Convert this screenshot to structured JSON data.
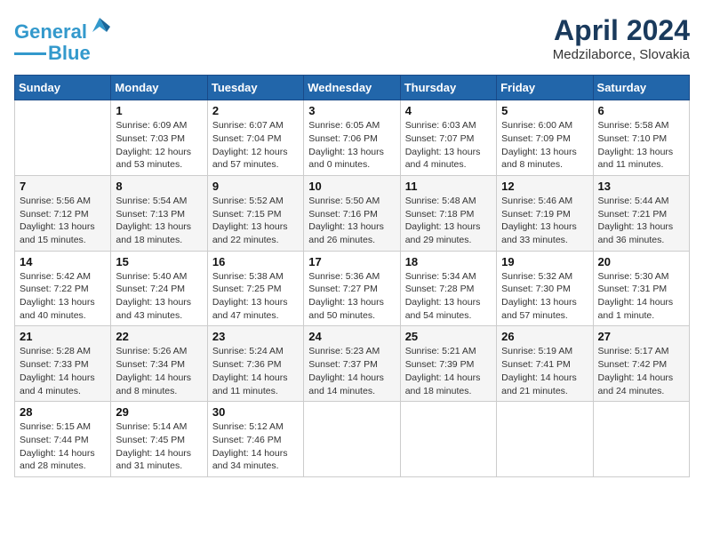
{
  "header": {
    "logo_line1": "General",
    "logo_line2": "Blue",
    "month_title": "April 2024",
    "location": "Medzilaborce, Slovakia"
  },
  "days_of_week": [
    "Sunday",
    "Monday",
    "Tuesday",
    "Wednesday",
    "Thursday",
    "Friday",
    "Saturday"
  ],
  "weeks": [
    [
      {
        "day": "",
        "sunrise": "",
        "sunset": "",
        "daylight": ""
      },
      {
        "day": "1",
        "sunrise": "Sunrise: 6:09 AM",
        "sunset": "Sunset: 7:03 PM",
        "daylight": "Daylight: 12 hours and 53 minutes."
      },
      {
        "day": "2",
        "sunrise": "Sunrise: 6:07 AM",
        "sunset": "Sunset: 7:04 PM",
        "daylight": "Daylight: 12 hours and 57 minutes."
      },
      {
        "day": "3",
        "sunrise": "Sunrise: 6:05 AM",
        "sunset": "Sunset: 7:06 PM",
        "daylight": "Daylight: 13 hours and 0 minutes."
      },
      {
        "day": "4",
        "sunrise": "Sunrise: 6:03 AM",
        "sunset": "Sunset: 7:07 PM",
        "daylight": "Daylight: 13 hours and 4 minutes."
      },
      {
        "day": "5",
        "sunrise": "Sunrise: 6:00 AM",
        "sunset": "Sunset: 7:09 PM",
        "daylight": "Daylight: 13 hours and 8 minutes."
      },
      {
        "day": "6",
        "sunrise": "Sunrise: 5:58 AM",
        "sunset": "Sunset: 7:10 PM",
        "daylight": "Daylight: 13 hours and 11 minutes."
      }
    ],
    [
      {
        "day": "7",
        "sunrise": "Sunrise: 5:56 AM",
        "sunset": "Sunset: 7:12 PM",
        "daylight": "Daylight: 13 hours and 15 minutes."
      },
      {
        "day": "8",
        "sunrise": "Sunrise: 5:54 AM",
        "sunset": "Sunset: 7:13 PM",
        "daylight": "Daylight: 13 hours and 18 minutes."
      },
      {
        "day": "9",
        "sunrise": "Sunrise: 5:52 AM",
        "sunset": "Sunset: 7:15 PM",
        "daylight": "Daylight: 13 hours and 22 minutes."
      },
      {
        "day": "10",
        "sunrise": "Sunrise: 5:50 AM",
        "sunset": "Sunset: 7:16 PM",
        "daylight": "Daylight: 13 hours and 26 minutes."
      },
      {
        "day": "11",
        "sunrise": "Sunrise: 5:48 AM",
        "sunset": "Sunset: 7:18 PM",
        "daylight": "Daylight: 13 hours and 29 minutes."
      },
      {
        "day": "12",
        "sunrise": "Sunrise: 5:46 AM",
        "sunset": "Sunset: 7:19 PM",
        "daylight": "Daylight: 13 hours and 33 minutes."
      },
      {
        "day": "13",
        "sunrise": "Sunrise: 5:44 AM",
        "sunset": "Sunset: 7:21 PM",
        "daylight": "Daylight: 13 hours and 36 minutes."
      }
    ],
    [
      {
        "day": "14",
        "sunrise": "Sunrise: 5:42 AM",
        "sunset": "Sunset: 7:22 PM",
        "daylight": "Daylight: 13 hours and 40 minutes."
      },
      {
        "day": "15",
        "sunrise": "Sunrise: 5:40 AM",
        "sunset": "Sunset: 7:24 PM",
        "daylight": "Daylight: 13 hours and 43 minutes."
      },
      {
        "day": "16",
        "sunrise": "Sunrise: 5:38 AM",
        "sunset": "Sunset: 7:25 PM",
        "daylight": "Daylight: 13 hours and 47 minutes."
      },
      {
        "day": "17",
        "sunrise": "Sunrise: 5:36 AM",
        "sunset": "Sunset: 7:27 PM",
        "daylight": "Daylight: 13 hours and 50 minutes."
      },
      {
        "day": "18",
        "sunrise": "Sunrise: 5:34 AM",
        "sunset": "Sunset: 7:28 PM",
        "daylight": "Daylight: 13 hours and 54 minutes."
      },
      {
        "day": "19",
        "sunrise": "Sunrise: 5:32 AM",
        "sunset": "Sunset: 7:30 PM",
        "daylight": "Daylight: 13 hours and 57 minutes."
      },
      {
        "day": "20",
        "sunrise": "Sunrise: 5:30 AM",
        "sunset": "Sunset: 7:31 PM",
        "daylight": "Daylight: 14 hours and 1 minute."
      }
    ],
    [
      {
        "day": "21",
        "sunrise": "Sunrise: 5:28 AM",
        "sunset": "Sunset: 7:33 PM",
        "daylight": "Daylight: 14 hours and 4 minutes."
      },
      {
        "day": "22",
        "sunrise": "Sunrise: 5:26 AM",
        "sunset": "Sunset: 7:34 PM",
        "daylight": "Daylight: 14 hours and 8 minutes."
      },
      {
        "day": "23",
        "sunrise": "Sunrise: 5:24 AM",
        "sunset": "Sunset: 7:36 PM",
        "daylight": "Daylight: 14 hours and 11 minutes."
      },
      {
        "day": "24",
        "sunrise": "Sunrise: 5:23 AM",
        "sunset": "Sunset: 7:37 PM",
        "daylight": "Daylight: 14 hours and 14 minutes."
      },
      {
        "day": "25",
        "sunrise": "Sunrise: 5:21 AM",
        "sunset": "Sunset: 7:39 PM",
        "daylight": "Daylight: 14 hours and 18 minutes."
      },
      {
        "day": "26",
        "sunrise": "Sunrise: 5:19 AM",
        "sunset": "Sunset: 7:41 PM",
        "daylight": "Daylight: 14 hours and 21 minutes."
      },
      {
        "day": "27",
        "sunrise": "Sunrise: 5:17 AM",
        "sunset": "Sunset: 7:42 PM",
        "daylight": "Daylight: 14 hours and 24 minutes."
      }
    ],
    [
      {
        "day": "28",
        "sunrise": "Sunrise: 5:15 AM",
        "sunset": "Sunset: 7:44 PM",
        "daylight": "Daylight: 14 hours and 28 minutes."
      },
      {
        "day": "29",
        "sunrise": "Sunrise: 5:14 AM",
        "sunset": "Sunset: 7:45 PM",
        "daylight": "Daylight: 14 hours and 31 minutes."
      },
      {
        "day": "30",
        "sunrise": "Sunrise: 5:12 AM",
        "sunset": "Sunset: 7:46 PM",
        "daylight": "Daylight: 14 hours and 34 minutes."
      },
      {
        "day": "",
        "sunrise": "",
        "sunset": "",
        "daylight": ""
      },
      {
        "day": "",
        "sunrise": "",
        "sunset": "",
        "daylight": ""
      },
      {
        "day": "",
        "sunrise": "",
        "sunset": "",
        "daylight": ""
      },
      {
        "day": "",
        "sunrise": "",
        "sunset": "",
        "daylight": ""
      }
    ]
  ]
}
